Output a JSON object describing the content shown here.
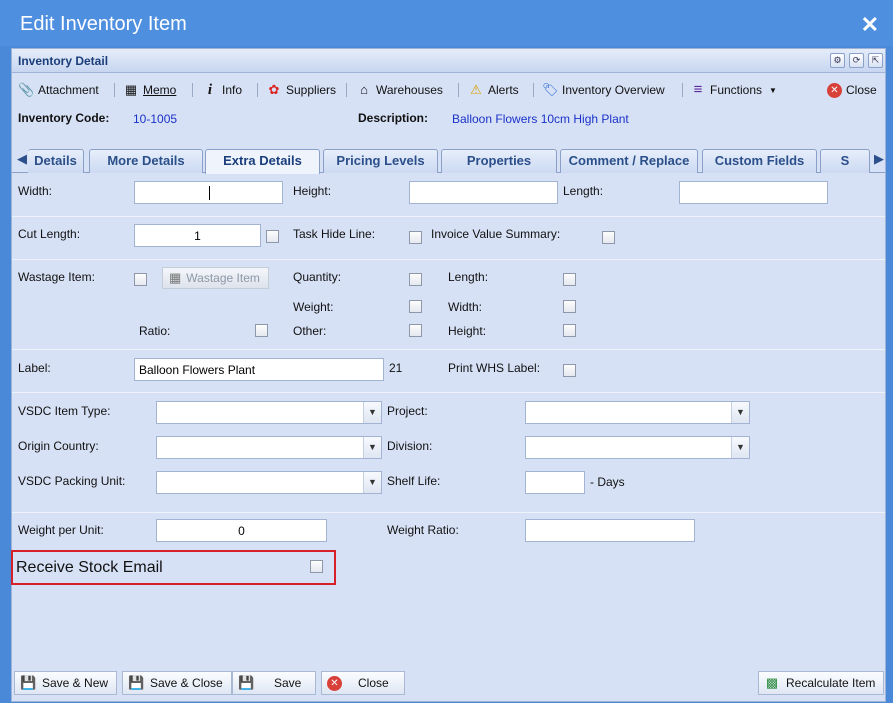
{
  "window": {
    "title": "Edit Inventory Item",
    "close_glyph": "✕"
  },
  "panel": {
    "title": "Inventory Detail"
  },
  "toolbar": {
    "attachment": "Attachment",
    "memo": "Memo",
    "info": "Info",
    "suppliers": "Suppliers",
    "warehouses": "Warehouses",
    "alerts": "Alerts",
    "inventory_overview": "Inventory Overview",
    "functions": "Functions",
    "close": "Close"
  },
  "item": {
    "code_label": "Inventory Code:",
    "code": "10-1005",
    "desc_label": "Description:",
    "description": "Balloon Flowers 10cm High Plant"
  },
  "tabs": [
    "Details",
    "More Details",
    "Extra Details",
    "Pricing Levels",
    "Properties",
    "Comment / Replace",
    "Custom Fields",
    "S"
  ],
  "form": {
    "width_label": "Width:",
    "width_value": "",
    "height_label": "Height:",
    "height_value": "",
    "length_label": "Length:",
    "length_value": "",
    "cut_length_label": "Cut Length:",
    "cut_length_value": "1",
    "task_hide_line_label": "Task Hide Line:",
    "invoice_value_summary_label": "Invoice Value Summary:",
    "wastage_item_label": "Wastage Item:",
    "wastage_item_button": "Wastage Item",
    "quantity_label": "Quantity:",
    "length2_label": "Length:",
    "weight_label": "Weight:",
    "width2_label": "Width:",
    "ratio_label": "Ratio:",
    "other_label": "Other:",
    "height2_label": "Height:",
    "label_label": "Label:",
    "label_value": "Balloon Flowers Plant",
    "label_count": "21",
    "print_whs_label": "Print WHS Label:",
    "vsdc_item_type_label": "VSDC Item Type:",
    "project_label": "Project:",
    "origin_country_label": "Origin Country:",
    "division_label": "Division:",
    "vsdc_packing_unit_label": "VSDC Packing Unit:",
    "shelf_life_label": "Shelf Life:",
    "shelf_life_value": "",
    "days_label": "- Days",
    "weight_per_unit_label": "Weight per Unit:",
    "weight_per_unit_value": "0",
    "weight_ratio_label": "Weight Ratio:",
    "weight_ratio_value": "",
    "receive_stock_email_label": "Receive Stock Email"
  },
  "footer": {
    "save_new": "Save & New",
    "save_close": "Save & Close",
    "save": "Save",
    "close": "Close",
    "recalculate": "Recalculate Item"
  },
  "colors": {
    "titlebar": "#4f8fe0",
    "panel_bg": "#d7e1f5",
    "link_blue": "#1a32c8",
    "highlight_red": "#d6202a"
  }
}
